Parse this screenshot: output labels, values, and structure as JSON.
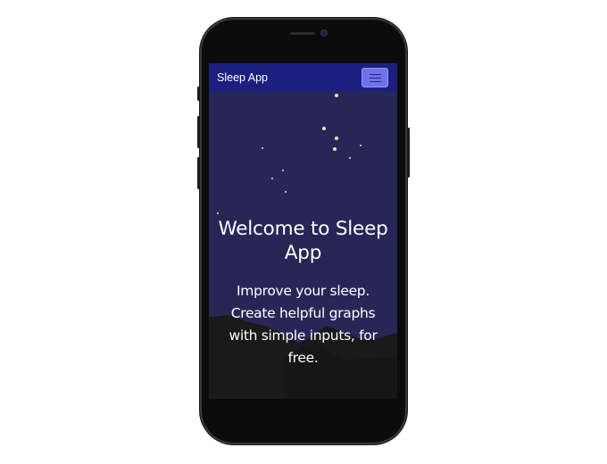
{
  "navbar": {
    "brand": "Sleep App",
    "menu_icon": "hamburger-menu-icon"
  },
  "hero": {
    "title": "Welcome to Sleep App",
    "subtitle": "Improve your sleep. Create helpful graphs with simple inputs, for free."
  },
  "colors": {
    "navbar": "#1d1f7e",
    "sky": "#272757",
    "mountains": "#1a1a1a",
    "menu_button": "#7171ee",
    "stars": "#f5e7a0"
  }
}
